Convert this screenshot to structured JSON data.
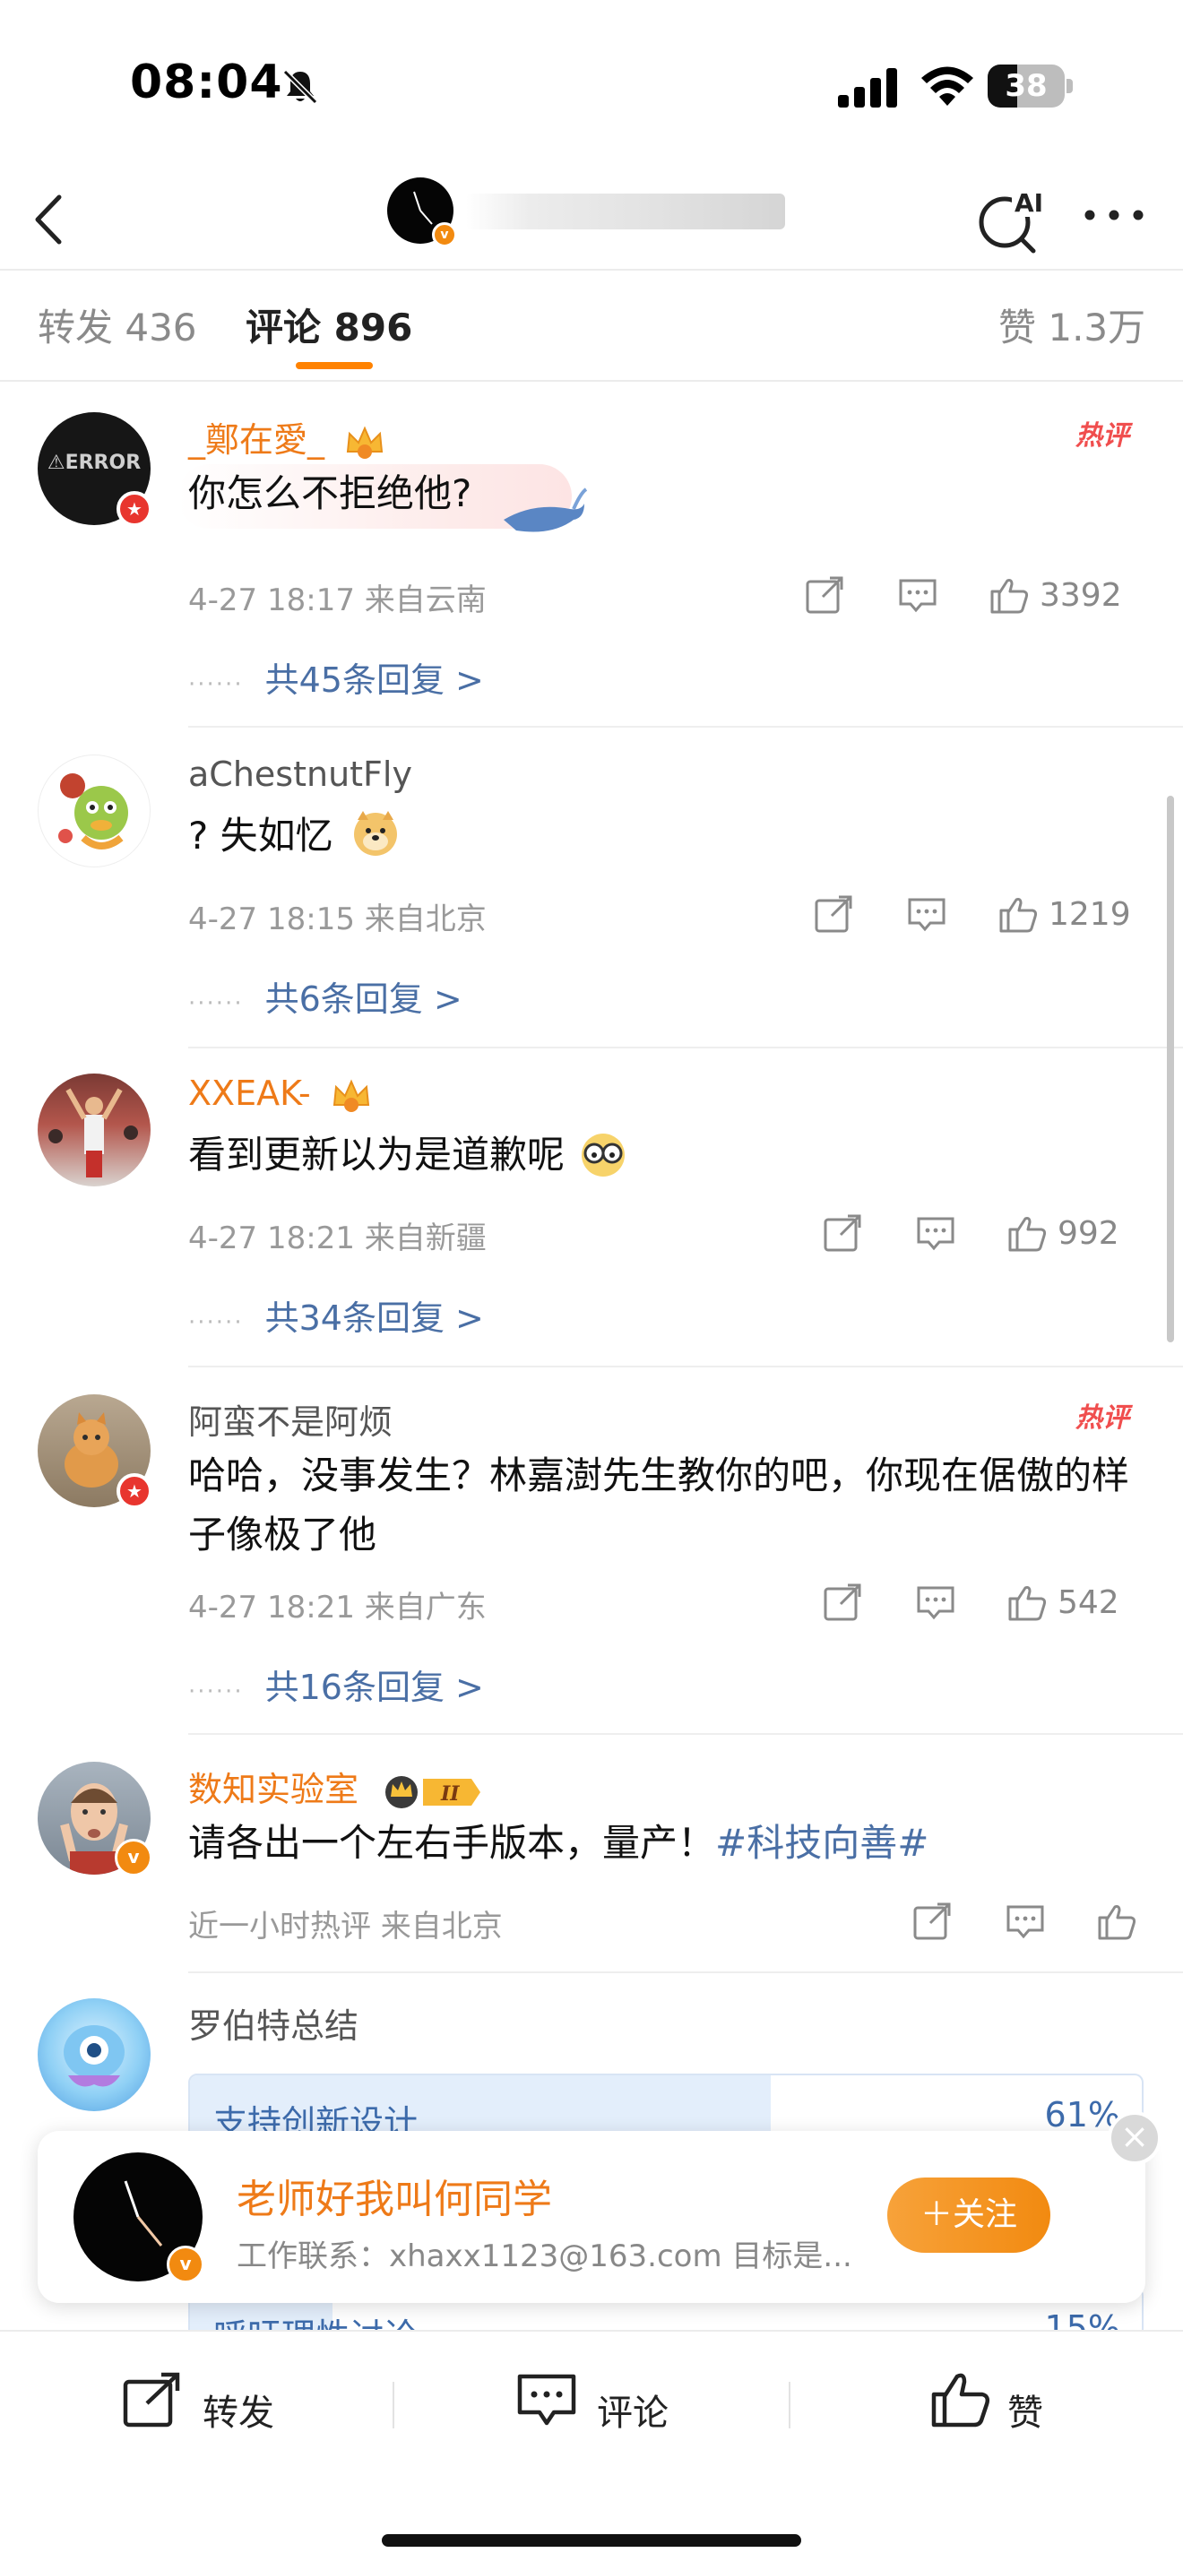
{
  "status_bar": {
    "time": "08:04",
    "battery": "38",
    "battery_level": 0.38
  },
  "header": {
    "back_icon": "chevron-left-icon",
    "ai_search_icon": "ai-search-icon",
    "ai_label": "AI",
    "more_icon": "more-icon"
  },
  "tabs": {
    "repost": "转发 436",
    "comments": "评论 896",
    "likes": "赞 1.3万"
  },
  "comments": [
    {
      "name": "_鄭在愛_",
      "text": "你怎么不拒绝他?",
      "meta": "4-27 18:17  来自云南",
      "likes": "3392",
      "replies": "共45条回复 >",
      "hot": "热评",
      "avatar_text": "⚠ERROR"
    },
    {
      "name": "aChestnutFly",
      "text": "? 失如忆",
      "meta": "4-27 18:15  来自北京",
      "likes": "1219",
      "replies": "共6条回复 >"
    },
    {
      "name": "XXEAK-",
      "text": "看到更新以为是道歉呢",
      "meta": "4-27 18:21  来自新疆",
      "likes": "992",
      "replies": "共34条回复 >"
    },
    {
      "name": "阿蛮不是阿烦",
      "text": "哈哈，没事发生？林嘉澍先生教你的吧，你现在倨傲的样子像极了他",
      "meta": "4-27 18:21  来自广东",
      "likes": "542",
      "replies": "共16条回复 >",
      "hot": "热评"
    },
    {
      "name": "数知实验室",
      "text_plain": "请各出一个左右手版本，量产！",
      "hashtag": "#科技向善#",
      "meta": "近一小时热评  来自北京",
      "badge_text": "II"
    },
    {
      "name": "罗伯特总结"
    }
  ],
  "poll": [
    {
      "label": "支持创新设计",
      "percent": "61%",
      "value": 0.61
    },
    {
      "label": "呼吁理性讨论",
      "percent": "15%",
      "value": 0.15
    }
  ],
  "follow_card": {
    "name": "老师好我叫何同学",
    "desc": "工作联系：xhaxx1123@163.com 目标是...",
    "button": "＋关注",
    "close": "×"
  },
  "bottom_bar": {
    "repost": "转发",
    "comment": "评论",
    "like": "赞"
  },
  "colors": {
    "accent": "#ff8200",
    "link": "#4a6fa5",
    "vip_name": "#ee7a18"
  }
}
